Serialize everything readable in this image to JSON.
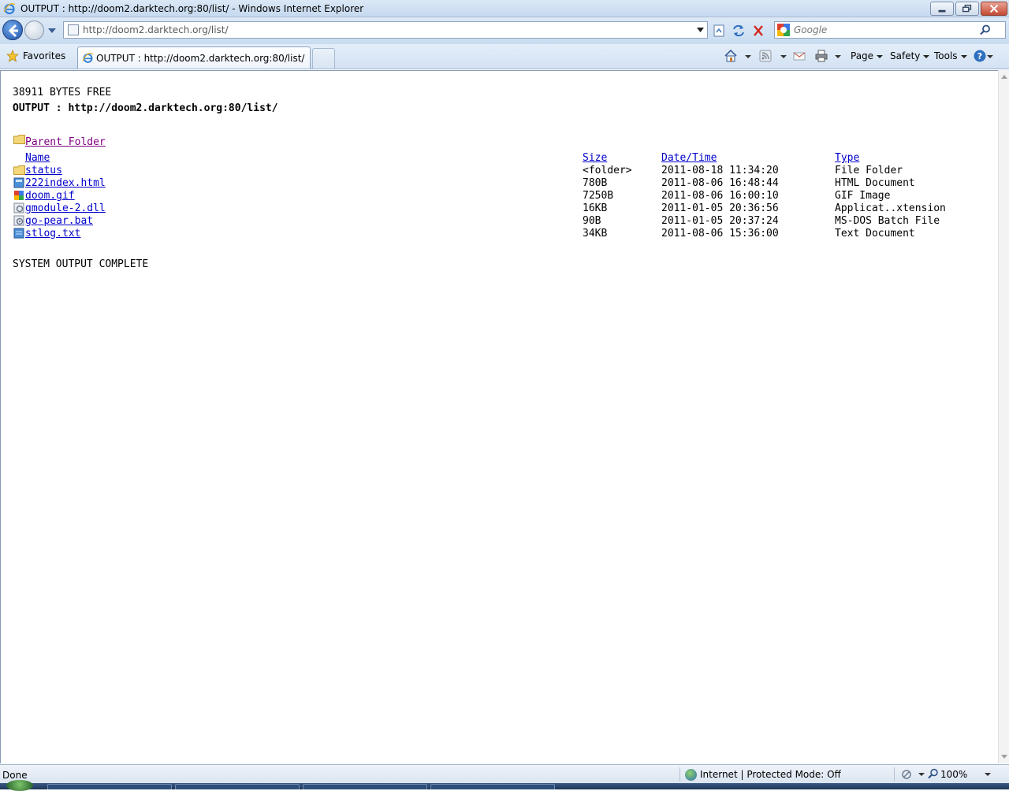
{
  "window": {
    "title": "OUTPUT : http://doom2.darktech.org:80/list/ - Windows Internet Explorer"
  },
  "navbar": {
    "address": "http://doom2.darktech.org/list/",
    "search_placeholder": "Google"
  },
  "tabbar": {
    "favorites_label": "Favorites",
    "tab_title": "OUTPUT : http://doom2.darktech.org:80/list/",
    "commands": {
      "page": "Page",
      "safety": "Safety",
      "tools": "Tools"
    }
  },
  "page": {
    "bytes_free": "38911 BYTES FREE",
    "output_line": "OUTPUT : http://doom2.darktech.org:80/list/",
    "parent_folder": "Parent Folder",
    "headers": {
      "name": "Name",
      "size": "Size",
      "datetime": "Date/Time",
      "type": "Type"
    },
    "files": [
      {
        "name": "status",
        "size": "<folder>",
        "datetime": "2011-08-18 11:34:20",
        "type": "File Folder",
        "icon": "folder-icon"
      },
      {
        "name": "222index.html",
        "size": "780B",
        "datetime": "2011-08-06 16:48:44",
        "type": "HTML Document",
        "icon": "html-file-icon"
      },
      {
        "name": "doom.gif",
        "size": "7250B",
        "datetime": "2011-08-06 16:00:10",
        "type": "GIF Image",
        "icon": "image-file-icon"
      },
      {
        "name": "gmodule-2.dll",
        "size": "16KB",
        "datetime": "2011-01-05 20:36:56",
        "type": "Applicat..xtension",
        "icon": "dll-file-icon"
      },
      {
        "name": "go-pear.bat",
        "size": "90B",
        "datetime": "2011-01-05 20:37:24",
        "type": "MS-DOS Batch File",
        "icon": "batch-file-icon"
      },
      {
        "name": "stlog.txt",
        "size": "34KB",
        "datetime": "2011-08-06 15:36:00",
        "type": "Text Document",
        "icon": "text-file-icon"
      }
    ],
    "complete": "SYSTEM OUTPUT COMPLETE"
  },
  "statusbar": {
    "status": "Done",
    "zone": "Internet | Protected Mode: Off",
    "zoom": "100%"
  },
  "colors": {
    "link": "#0000cc",
    "visited_link": "#800080",
    "chrome": "#dce9f7"
  }
}
